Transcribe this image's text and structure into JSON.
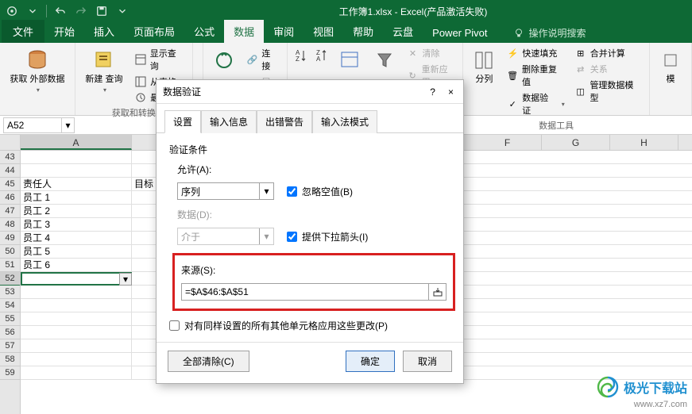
{
  "titlebar": {
    "doc": "工作簿1.xlsx",
    "app": "Excel(产品激活失败)"
  },
  "tabs": {
    "file": "文件",
    "home": "开始",
    "insert": "插入",
    "layout": "页面布局",
    "formulas": "公式",
    "data": "数据",
    "review": "审阅",
    "view": "视图",
    "help": "帮助",
    "cloud": "云盘",
    "powerpivot": "Power Pivot",
    "tellme": "操作说明搜索"
  },
  "ribbon": {
    "get_ext": "获取\n外部数据",
    "new_query": "新建\n查询",
    "show_queries": "显示查询",
    "from_table": "从表格",
    "recent": "最近使",
    "group1_label": "获取和转换",
    "refresh": "全部刷新",
    "connections": "连接",
    "properties": "属性",
    "sort": "排序",
    "filter": "筛选",
    "clear": "清除",
    "reapply": "重新应用",
    "split": "分列",
    "flash": "快速填充",
    "dedup": "删除重复值",
    "validation": "数据验证",
    "consolidate": "合并计算",
    "relations": "关系",
    "datamodel": "管理数据模型",
    "datatools_label": "数据工具",
    "simulate": "模"
  },
  "namebox": "A52",
  "colHeaders": [
    "A",
    "F",
    "G",
    "H"
  ],
  "rows": [
    {
      "n": "43",
      "a": ""
    },
    {
      "n": "44",
      "a": ""
    },
    {
      "n": "45",
      "a": "责任人",
      "b": "目标"
    },
    {
      "n": "46",
      "a": "员工 1"
    },
    {
      "n": "47",
      "a": "员工 2"
    },
    {
      "n": "48",
      "a": "员工 3"
    },
    {
      "n": "49",
      "a": "员工 4"
    },
    {
      "n": "50",
      "a": "员工 5"
    },
    {
      "n": "51",
      "a": "员工 6"
    },
    {
      "n": "52",
      "a": ""
    },
    {
      "n": "53",
      "a": ""
    },
    {
      "n": "54",
      "a": ""
    },
    {
      "n": "55",
      "a": ""
    },
    {
      "n": "56",
      "a": ""
    },
    {
      "n": "57",
      "a": ""
    },
    {
      "n": "58",
      "a": ""
    },
    {
      "n": "59",
      "a": ""
    }
  ],
  "dialog": {
    "title": "数据验证",
    "help": "?",
    "close": "×",
    "tabs": {
      "settings": "设置",
      "input": "输入信息",
      "error": "出错警告",
      "ime": "输入法模式"
    },
    "criteria_label": "验证条件",
    "allow_label": "允许(A):",
    "allow_value": "序列",
    "data_label": "数据(D):",
    "data_value": "介于",
    "ignore_blank": "忽略空值(B)",
    "dropdown": "提供下拉箭头(I)",
    "source_label": "来源(S):",
    "source_value": "=$A$46:$A$51",
    "apply_all": "对有同样设置的所有其他单元格应用这些更改(P)",
    "clear_all": "全部清除(C)",
    "ok": "确定",
    "cancel": "取消"
  },
  "watermark": {
    "brand": "极光下载站",
    "url": "www.xz7.com"
  }
}
